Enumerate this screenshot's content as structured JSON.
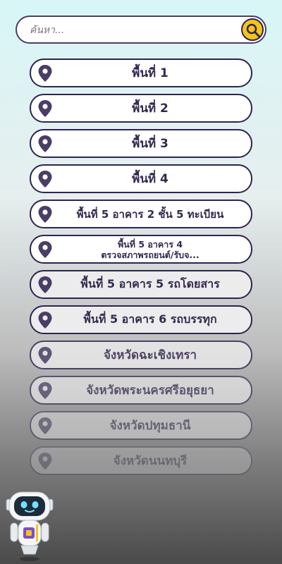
{
  "search": {
    "placeholder": "ค้นหา...",
    "value": ""
  },
  "items": [
    {
      "label": "พื้นที่ 1"
    },
    {
      "label": "พื้นที่ 2"
    },
    {
      "label": "พื้นที่ 3"
    },
    {
      "label": "พื้นที่ 4"
    },
    {
      "label": "พื้นที่ 5 อาคาร 2 ชั้น 5 ทะเบียน"
    },
    {
      "label_line1": "พื้นที่ 5 อาคาร 4",
      "label_line2": "ตรวจสภาพรถยนต์/รับจ..."
    },
    {
      "label": "พื้นที่ 5 อาคาร 5 รถโดยสาร"
    },
    {
      "label": "พื้นที่ 5 อาคาร 6 รถบรรทุก"
    },
    {
      "label": "จังหวัดฉะเชิงเทรา"
    },
    {
      "label": "จังหวัดพระนครศรีอยุธยา"
    },
    {
      "label": "จังหวัดปทุมธานี"
    },
    {
      "label": "จังหวัดนนทบุรี"
    }
  ],
  "icons": {
    "location": "map-pin-icon",
    "search": "search-icon",
    "assistant": "robot-assistant-icon"
  },
  "colors": {
    "accent": "#f5c518",
    "border": "#2e2450",
    "text": "#35294f"
  }
}
